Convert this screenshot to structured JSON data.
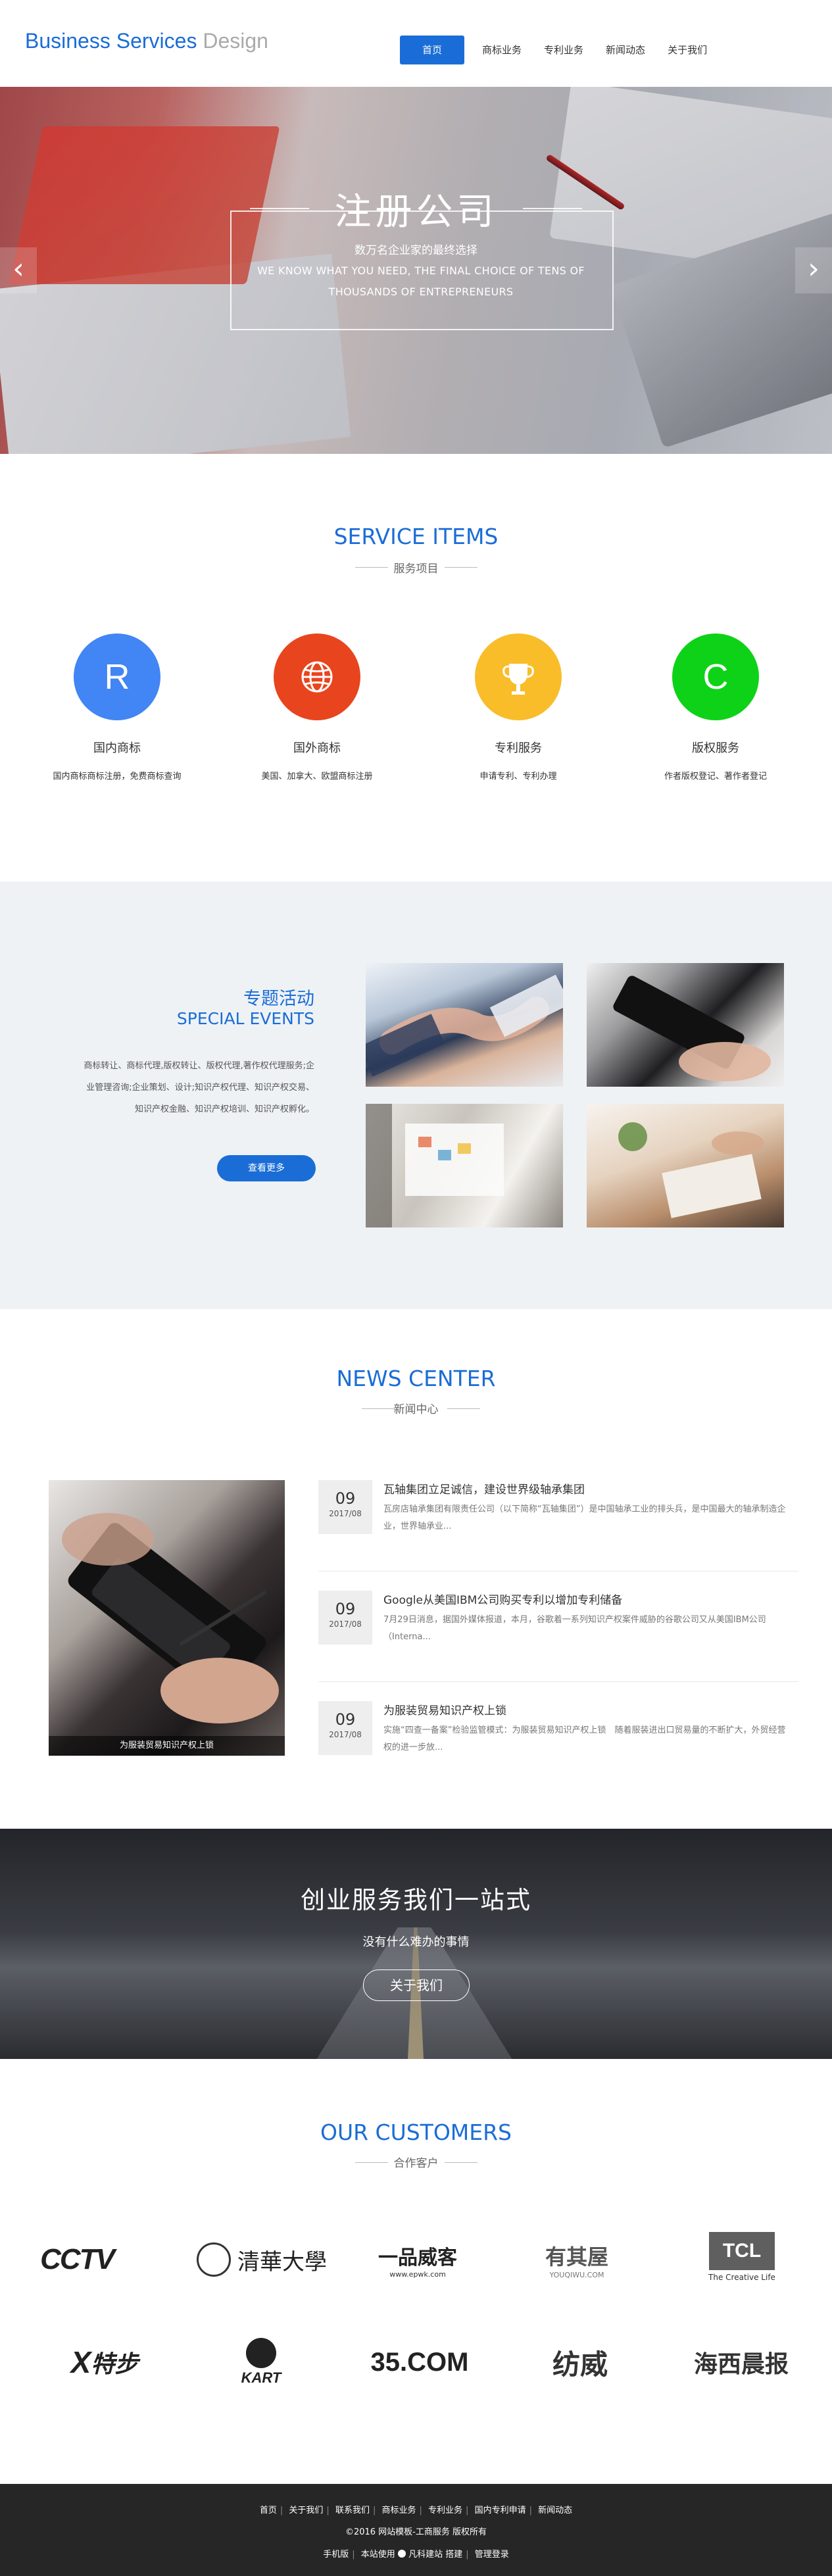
{
  "header": {
    "logo_blue": "Business Services",
    "logo_gray": "Design",
    "nav": [
      "首页",
      "商标业务",
      "专利业务",
      "新闻动态",
      "关于我们"
    ]
  },
  "banner": {
    "title": "注册公司",
    "subtitle": "数万名企业家的最终选择",
    "english": "WE KNOW WHAT YOU NEED, THE FINAL CHOICE OF TENS OF THOUSANDS OF ENTREPRENEURS",
    "prev": "‹",
    "next": "›"
  },
  "services": {
    "title": "SERVICE ITEMS",
    "subtitle": "服务项目",
    "items": [
      {
        "glyph": "R",
        "icon": "registered-icon",
        "color": "#4285f4",
        "name": "国内商标",
        "desc": "国内商标商标注册，免费商标查询"
      },
      {
        "glyph": "",
        "icon": "globe-icon",
        "color": "#e8451e",
        "name": "国外商标",
        "desc": "美国、加拿大、欧盟商标注册"
      },
      {
        "glyph": "",
        "icon": "trophy-icon",
        "color": "#f9bd29",
        "name": "专利服务",
        "desc": "申请专利、专利办理"
      },
      {
        "glyph": "C",
        "icon": "copyright-icon",
        "color": "#0ed217",
        "name": "版权服务",
        "desc": "作者版权登记、著作者登记"
      }
    ]
  },
  "events": {
    "title_cn": "专题活动",
    "title_en": "SPECIAL EVENTS",
    "desc": "商标转让、商标代理,版权转让、版权代理,著作权代理服务;企业管理咨询;企业策划、设计;知识产权代理、知识产权交易、知识产权金融、知识产权培训、知识产权孵化。",
    "button": "查看更多"
  },
  "news": {
    "title": "NEWS CENTER",
    "subtitle": "新闻中心",
    "image_caption": "为服装贸易知识产权上锁",
    "items": [
      {
        "day": "09",
        "month": "2017/08",
        "title": "瓦轴集团立足诚信，建设世界级轴承集团",
        "summary": "瓦房店轴承集团有限责任公司（以下简称“瓦轴集团”）是中国轴承工业的排头兵，是中国最大的轴承制造企业，世界轴承业..."
      },
      {
        "day": "09",
        "month": "2017/08",
        "title": "Google从美国IBM公司购买专利以增加专利储备",
        "summary": "7月29日消息，据国外媒体报道，本月，谷歌着一系列知识产权案件威胁的谷歌公司又从美国IBM公司（Interna..."
      },
      {
        "day": "09",
        "month": "2017/08",
        "title": "为服装贸易知识产权上锁",
        "summary": "实施“四查一备案”检验监管模式：为服装贸易知识产权上锁　随着服装进出口贸易量的不断扩大，外贸经营权的进一步放..."
      }
    ]
  },
  "cta": {
    "title": "创业服务我们一站式",
    "subtitle": "没有什么难办的事情",
    "button": "关于我们"
  },
  "customers": {
    "title": "OUR CUSTOMERS",
    "subtitle": "合作客户",
    "logos": [
      {
        "text": "CCTV",
        "icon": "cctv-logo"
      },
      {
        "text": "清華大學",
        "icon": "tsinghua-logo"
      },
      {
        "text": "一品威客",
        "sub": "www.epwk.com",
        "icon": "epwk-logo"
      },
      {
        "text": "有其屋",
        "sub": "YOUQIWU.COM",
        "icon": "youqiwu-logo"
      },
      {
        "text": "TCL",
        "sub": "The Creative Life",
        "icon": "tcl-logo"
      },
      {
        "text": "特步",
        "icon": "xtep-logo"
      },
      {
        "text": "KART",
        "icon": "kart-logo"
      },
      {
        "text": "35.COM",
        "icon": "35com-logo"
      },
      {
        "text": "纺威",
        "icon": "fangwei-logo"
      },
      {
        "text": "海西晨报",
        "icon": "haixi-logo"
      }
    ]
  },
  "footer": {
    "links": [
      "首页",
      "关于我们",
      "联系我们",
      "商标业务",
      "专利业务",
      "国内专利申请",
      "新闻动态"
    ],
    "copyright": "©2016 网站模板-工商服务 版权所有",
    "mobile": "手机版",
    "support_prefix": "本站使用",
    "support_brand": "凡科建站",
    "support_suffix": "搭建",
    "admin": "管理登录"
  }
}
